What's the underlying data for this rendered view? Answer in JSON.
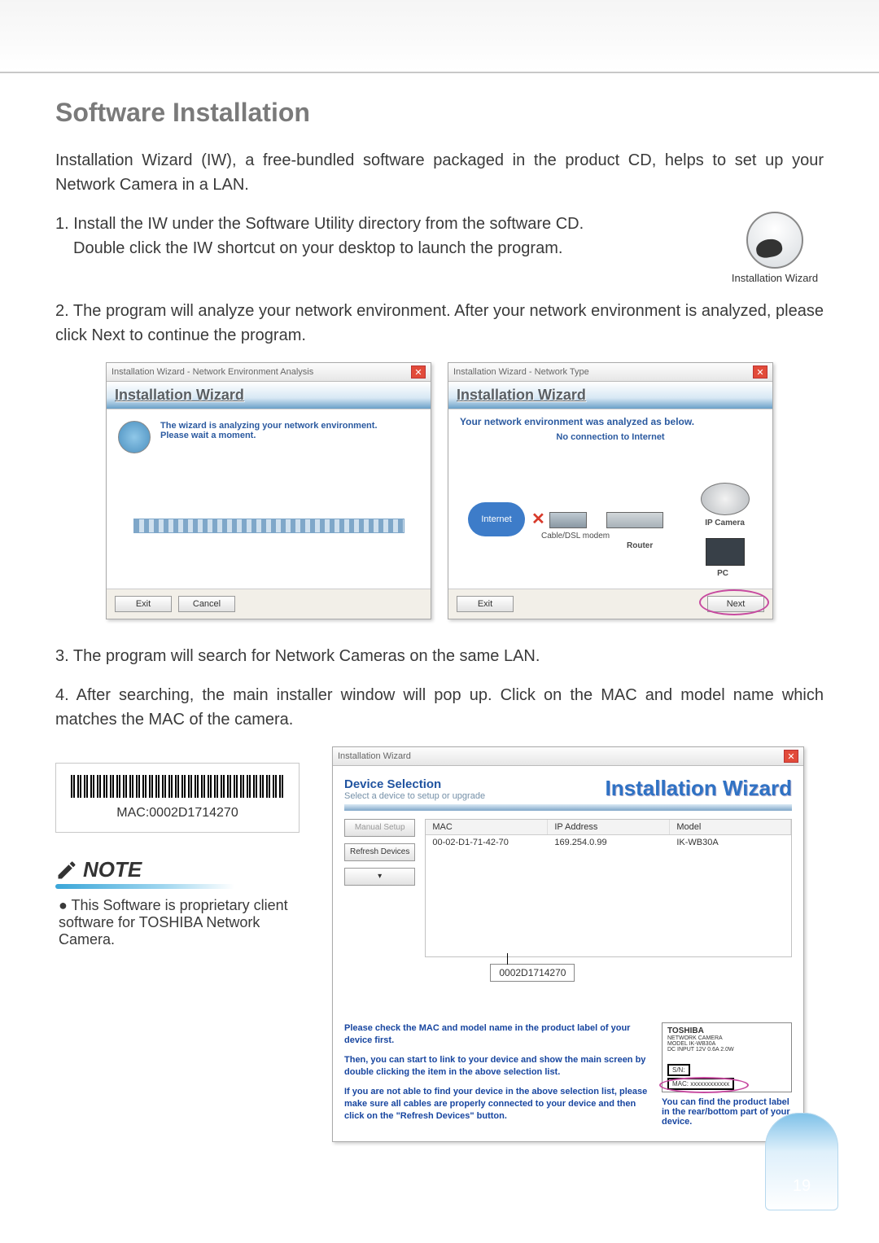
{
  "page": {
    "title": "Software Installation",
    "intro": "Installation Wizard (IW), a free-bundled software packaged in the product CD, helps to set up your Network Camera in a LAN.",
    "step1_line1": "1. Install the IW under the Software Utility directory from the software CD.",
    "step1_line2": "Double click the IW shortcut on your desktop to launch the program.",
    "iw_icon_label": "Installation Wizard",
    "step2": "2. The program will analyze your network environment. After your network environment is analyzed, please click Next to continue the program.",
    "step3": "3. The program will search for Network Cameras on the same LAN.",
    "step4": "4. After searching, the main installer window will pop up. Click on the MAC and model name which matches the MAC of the camera.",
    "page_number": "19"
  },
  "shot1": {
    "title": "Installation Wizard - Network Environment Analysis",
    "header": "Installation Wizard",
    "msg1": "The wizard is analyzing your network environment.",
    "msg2": "Please wait a moment.",
    "btn_exit": "Exit",
    "btn_cancel": "Cancel"
  },
  "shot2": {
    "title": "Installation Wizard - Network Type",
    "header": "Installation Wizard",
    "env_line": "Your network environment was analyzed as below.",
    "noconn": "No connection to Internet",
    "cloud": "Internet",
    "modem": "Cable/DSL modem",
    "router": "Router",
    "cam": "IP Camera",
    "pc": "PC",
    "btn_exit": "Exit",
    "btn_next": "Next"
  },
  "mac_card": {
    "text": "MAC:0002D1714270"
  },
  "note": {
    "heading": "NOTE",
    "bullet": "● This Software is proprietary client software for TOSHIBA Network Camera."
  },
  "shot3": {
    "title": "Installation Wizard",
    "ds_title": "Device Selection",
    "ds_sub": "Select a device to setup or upgrade",
    "ds_brand": "Installation Wizard",
    "btn_manual": "Manual Setup",
    "btn_refresh": "Refresh Devices",
    "btn_more": "▾",
    "th_mac": "MAC",
    "th_ip": "IP Address",
    "th_model": "Model",
    "row_mac": "00-02-D1-71-42-70",
    "row_ip": "169.254.0.99",
    "row_model": "IK-WB30A",
    "callout": "0002D1714270",
    "info_p1": "Please check the MAC and model name in the product label of your device first.",
    "info_p2": "Then, you can start to link to your device and show the main screen by double clicking the item in the above selection list.",
    "info_p3": "If you are not able to find your device in the above selection list, please make sure all cables are properly connected to your device and then click on the \"Refresh Devices\" button.",
    "label_brand": "TOSHIBA",
    "label_model": "NETWORK CAMERA",
    "label_model2": "MODEL IK-WB30A",
    "label_dc": "DC INPUT 12V 0.6A 2.0W",
    "label_sn": "S/N:",
    "label_mac": "MAC: xxxxxxxxxxxx",
    "label_hint": "You can find the product label in the rear/bottom part of your device."
  }
}
